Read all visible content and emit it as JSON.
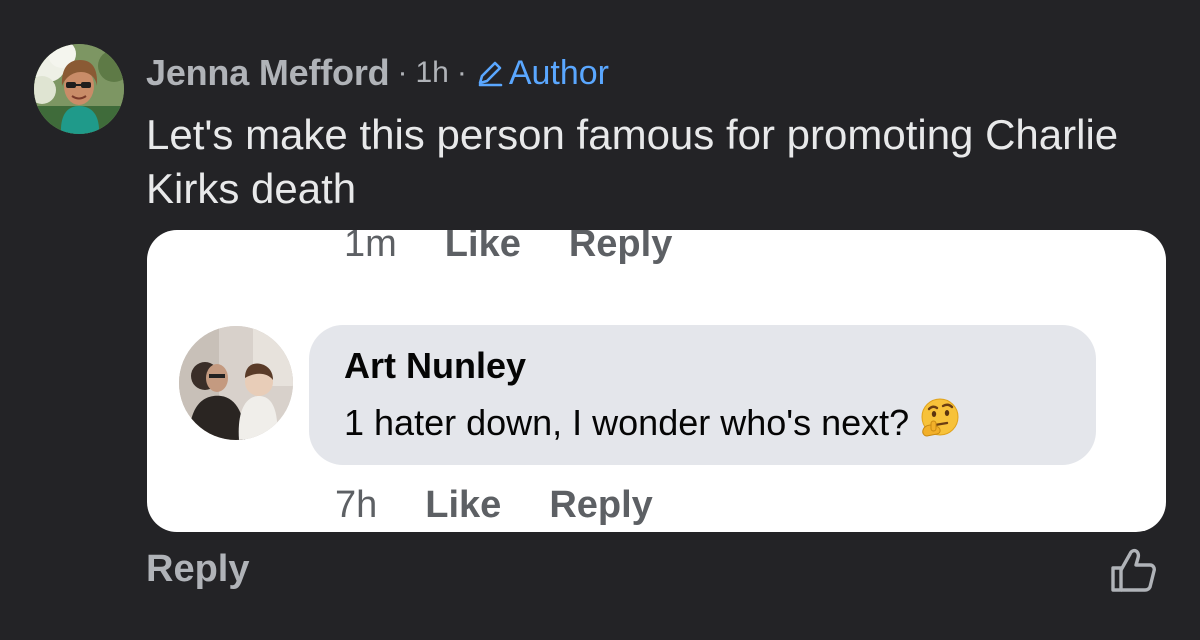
{
  "comment": {
    "author": "Jenna Mefford",
    "separator": "·",
    "time": "1h",
    "badge_icon": "pencil-icon",
    "badge_label": "Author",
    "text": "Let's make this person famous for promoting Charlie Kirks death",
    "reply_label": "Reply",
    "like_icon": "thumbs-up-icon"
  },
  "screenshot": {
    "top_actions": {
      "time": "1m",
      "like_label": "Like",
      "reply_label": "Reply"
    },
    "inner_comment": {
      "author": "Art Nunley",
      "text": "1 hater down, I wonder who's next?",
      "emoji": "thinking-face-emoji"
    },
    "bottom_actions": {
      "time": "7h",
      "like_label": "Like",
      "reply_label": "Reply"
    }
  },
  "colors": {
    "background": "#232326",
    "secondary_text": "#b0b3b8",
    "primary_text": "#e8e9ea",
    "author_badge": "#5aa7ff",
    "card_background": "#ffffff",
    "bubble_background": "#e4e6eb"
  }
}
